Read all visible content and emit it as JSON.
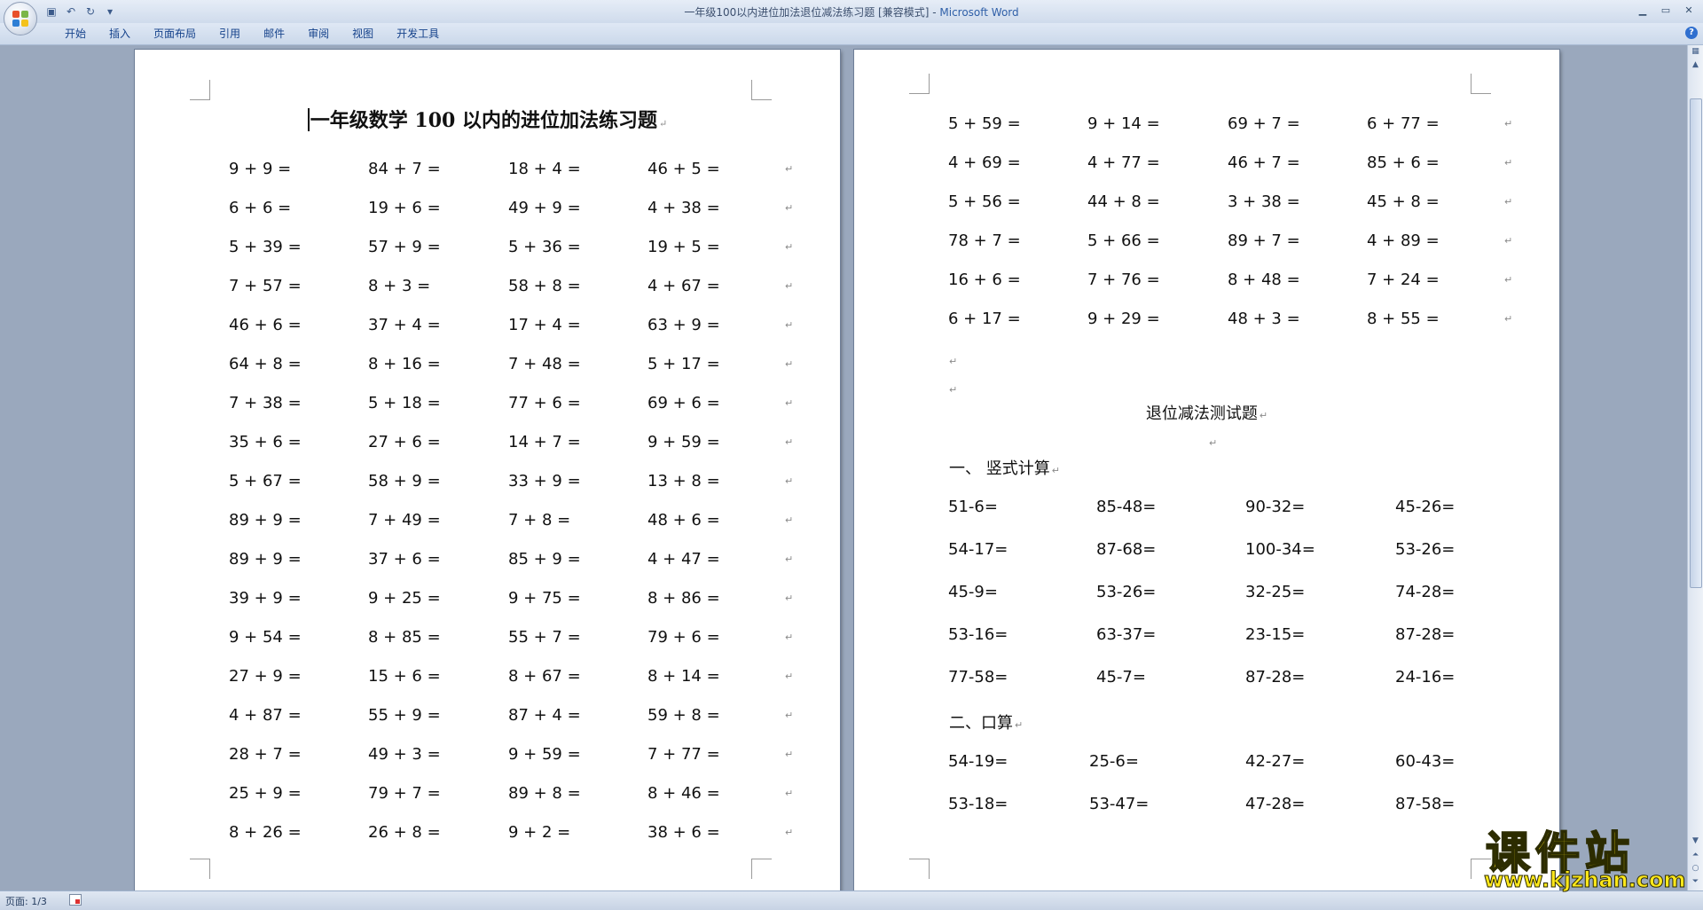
{
  "window": {
    "title": "一年级100以内进位加法退位减法练习题 [兼容模式] - ",
    "app_name": "Microsoft Word"
  },
  "ribbon": {
    "tabs": [
      "开始",
      "插入",
      "页面布局",
      "引用",
      "邮件",
      "审阅",
      "视图",
      "开发工具"
    ]
  },
  "page1": {
    "title": "一年级数学 100 以内的进位加法练习题",
    "rows": [
      [
        "9 + 9 =",
        "84 + 7 =",
        "18 + 4 =",
        "46 + 5 ="
      ],
      [
        "6 + 6 =",
        "19 + 6 =",
        "49 + 9 =",
        "4 + 38 ="
      ],
      [
        "5 + 39 =",
        "57 + 9 =",
        "5 + 36 =",
        "19 + 5 ="
      ],
      [
        "7 + 57 =",
        "8 + 3 =",
        "58 + 8 =",
        "4 + 67 ="
      ],
      [
        "46 + 6 =",
        "37 + 4 =",
        "17 + 4 =",
        "63 + 9 ="
      ],
      [
        "64 + 8 =",
        "8 + 16 =",
        "7 + 48 =",
        "5 + 17 ="
      ],
      [
        "7 + 38 =",
        "5 + 18 =",
        "77 + 6 =",
        "69 + 6 ="
      ],
      [
        "35 + 6 =",
        "27 + 6 =",
        "14 + 7 =",
        "9 + 59 ="
      ],
      [
        "5 + 67 =",
        "58 + 9 =",
        "33 + 9 =",
        "13 + 8 ="
      ],
      [
        "89 + 9 =",
        "7 + 49 =",
        "7 + 8 =",
        "48 + 6 ="
      ],
      [
        "89 + 9 =",
        "37 + 6 =",
        "85 + 9 =",
        "4 + 47 ="
      ],
      [
        "39 + 9 =",
        "9 + 25 =",
        "9 + 75 =",
        "8 + 86 ="
      ],
      [
        "9 + 54 =",
        "8 + 85 =",
        "55 + 7 =",
        "79 + 6 ="
      ],
      [
        "27 + 9 =",
        "15 + 6 =",
        "8 + 67 =",
        "8 + 14 ="
      ],
      [
        "4 + 87 =",
        "55 + 9 =",
        "87 + 4 =",
        "59 + 8 ="
      ],
      [
        "28 + 7 =",
        "49 + 3 =",
        "9 + 59 =",
        "7 + 77 ="
      ],
      [
        "25 + 9 =",
        "79 + 7 =",
        "89 + 8 =",
        "8 + 46 ="
      ],
      [
        "8 + 26 =",
        "26 + 8 =",
        "9 + 2 =",
        "38 + 6 ="
      ]
    ]
  },
  "page2": {
    "add_rows": [
      [
        "5 + 59 =",
        "9 + 14 =",
        "69 + 7 =",
        "6 + 77 ="
      ],
      [
        "4 + 69 =",
        "4 + 77 =",
        "46 + 7 =",
        "85 + 6 ="
      ],
      [
        "5 + 56 =",
        "44 + 8 =",
        "3 + 38 =",
        "45 + 8 ="
      ],
      [
        "78 + 7 =",
        "5 + 66 =",
        "89 + 7 =",
        "4 + 89 ="
      ],
      [
        "16 + 6 =",
        "7 + 76 =",
        "8 + 48 =",
        "7 + 24 ="
      ],
      [
        "6 + 17 =",
        "9 + 29 =",
        "48 + 3 =",
        "8 + 55 ="
      ]
    ],
    "sub_title": "退位减法测试题",
    "section1_title": "一、  竖式计算",
    "section1_rows": [
      [
        "51-6=",
        "85-48=",
        "90-32=",
        "45-26="
      ],
      [
        "54-17=",
        "87-68=",
        "100-34=",
        "53-26="
      ],
      [
        "45-9=",
        "53-26=",
        "32-25=",
        "74-28="
      ],
      [
        "53-16=",
        "63-37=",
        "23-15=",
        "87-28="
      ],
      [
        "77-58=",
        "45-7=",
        "87-28=",
        "24-16="
      ]
    ],
    "section2_title": "二、口算",
    "section2_rows": [
      [
        "54-19=",
        "25-6=",
        "42-27=",
        "60-43="
      ],
      [
        "53-18=",
        "53-47=",
        "47-28=",
        "87-58="
      ]
    ]
  },
  "status": {
    "page_info": "页面: 1/3"
  },
  "watermark": {
    "cn": "课件站",
    "url": "www.kjzhan.com"
  },
  "colors": {
    "ribbon_text": "#15428b",
    "workspace_bg": "#9aa8bd",
    "watermark_yellow": "#ffe81a"
  }
}
